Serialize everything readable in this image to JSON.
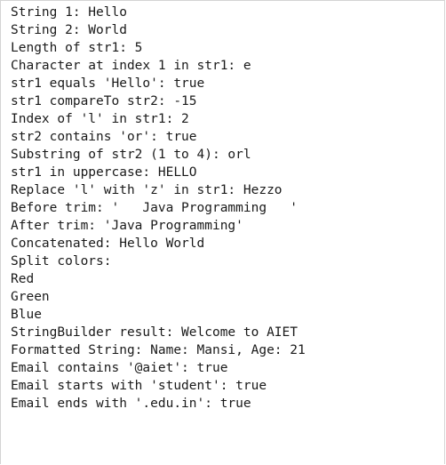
{
  "console": {
    "lines": [
      "String 1: Hello",
      "String 2: World",
      "Length of str1: 5",
      "Character at index 1 in str1: e",
      "str1 equals 'Hello': true",
      "str1 compareTo str2: -15",
      "Index of 'l' in str1: 2",
      "str2 contains 'or': true",
      "Substring of str2 (1 to 4): orl",
      "str1 in uppercase: HELLO",
      "Replace 'l' with 'z' in str1: Hezzo",
      "Before trim: '   Java Programming   '",
      "After trim: 'Java Programming'",
      "Concatenated: Hello World",
      "Split colors:",
      "Red",
      "Green",
      "Blue",
      "StringBuilder result: Welcome to AIET",
      "Formatted String: Name: Mansi, Age: 21",
      "Email contains '@aiet': true",
      "Email starts with 'student': true",
      "Email ends with '.edu.in': true"
    ]
  }
}
